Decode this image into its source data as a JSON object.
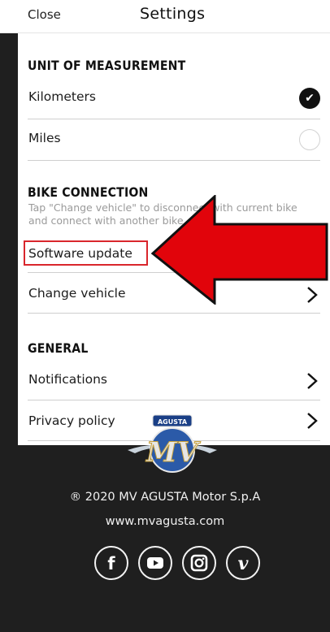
{
  "header": {
    "close_label": "Close",
    "title": "Settings"
  },
  "unit_section": {
    "heading": "UNIT OF MEASUREMENT",
    "options": [
      {
        "label": "Kilometers",
        "selected": true
      },
      {
        "label": "Miles",
        "selected": false
      }
    ]
  },
  "bike_section": {
    "heading": "BIKE CONNECTION",
    "description": "Tap \"Change vehicle\" to disconnect with current bike and connect with another bike",
    "software_update_label": "Software update",
    "change_vehicle_label": "Change vehicle"
  },
  "general_section": {
    "heading": "GENERAL",
    "notifications_label": "Notifications",
    "privacy_label": "Privacy policy"
  },
  "footer": {
    "copyright": "® 2020 MV AGUSTA Motor S.p.A",
    "website": "www.mvagusta.com",
    "social": [
      "facebook-icon",
      "youtube-icon",
      "instagram-icon",
      "vimeo-icon"
    ]
  },
  "logo": {
    "text": "MV",
    "badge_text": "AGUSTA"
  },
  "colors": {
    "highlight": "#d9262c",
    "arrow": "#e1040b",
    "footer_bg": "#1f1f1f"
  }
}
